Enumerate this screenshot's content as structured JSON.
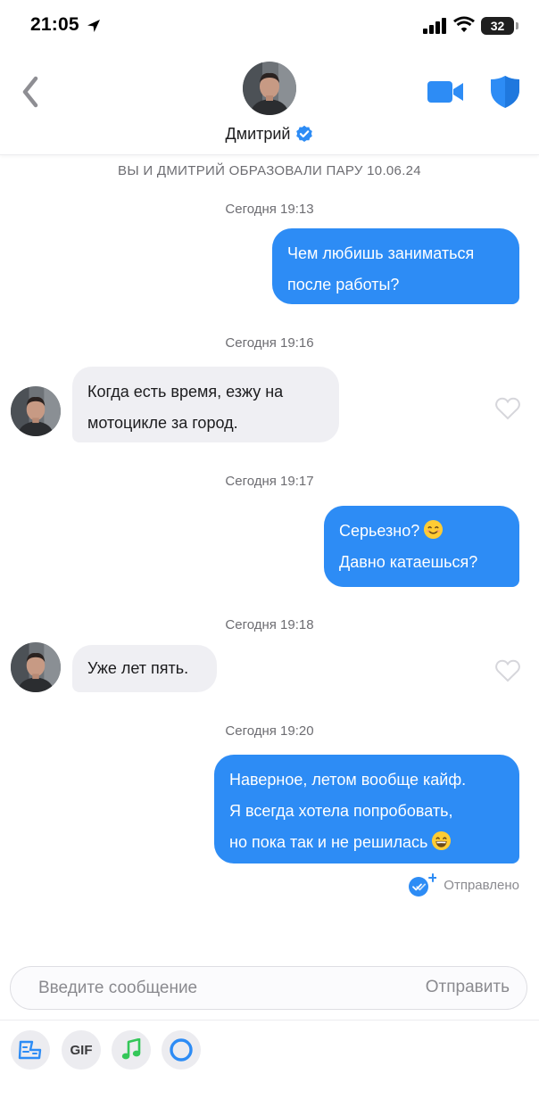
{
  "status_bar": {
    "time": "21:05",
    "battery": "32"
  },
  "header": {
    "contact_name": "Дмитрий",
    "verified": true
  },
  "chat": {
    "match_banner": "ВЫ И ДМИТРИЙ ОБРАЗОВАЛИ ПАРУ 10.06.24",
    "messages": [
      {
        "time": "Сегодня 19:13",
        "direction": "outgoing",
        "lines": [
          "Чем любишь заниматься",
          "после работы?"
        ]
      },
      {
        "time": "Сегодня 19:16",
        "direction": "incoming",
        "lines": [
          "Когда есть время, езжу на",
          "мотоцикле за город."
        ]
      },
      {
        "time": "Сегодня 19:17",
        "direction": "outgoing",
        "lines": [
          "Серьезно?",
          "Давно катаешься?"
        ],
        "emoji": "😊"
      },
      {
        "time": "Сегодня 19:18",
        "direction": "incoming",
        "lines": [
          "Уже лет пять."
        ]
      },
      {
        "time": "Сегодня 19:20",
        "direction": "outgoing",
        "lines": [
          "Наверное, летом вообще кайф.",
          "Я всегда хотела попробовать,",
          "но пока так и не решилась"
        ],
        "emoji": "😁"
      }
    ],
    "status": "Отправлено"
  },
  "composer": {
    "placeholder": "Введите сообщение",
    "send_label": "Отправить"
  },
  "toolbar": {
    "gif_label": "GIF",
    "tools": [
      "sticker-icon",
      "gif-icon",
      "music-note-icon",
      "ring-icon"
    ]
  },
  "colors": {
    "accent": "#2d8cf5",
    "incoming_bubble": "#efeff3",
    "muted_text": "#6d6d72",
    "music_green": "#34c759"
  }
}
